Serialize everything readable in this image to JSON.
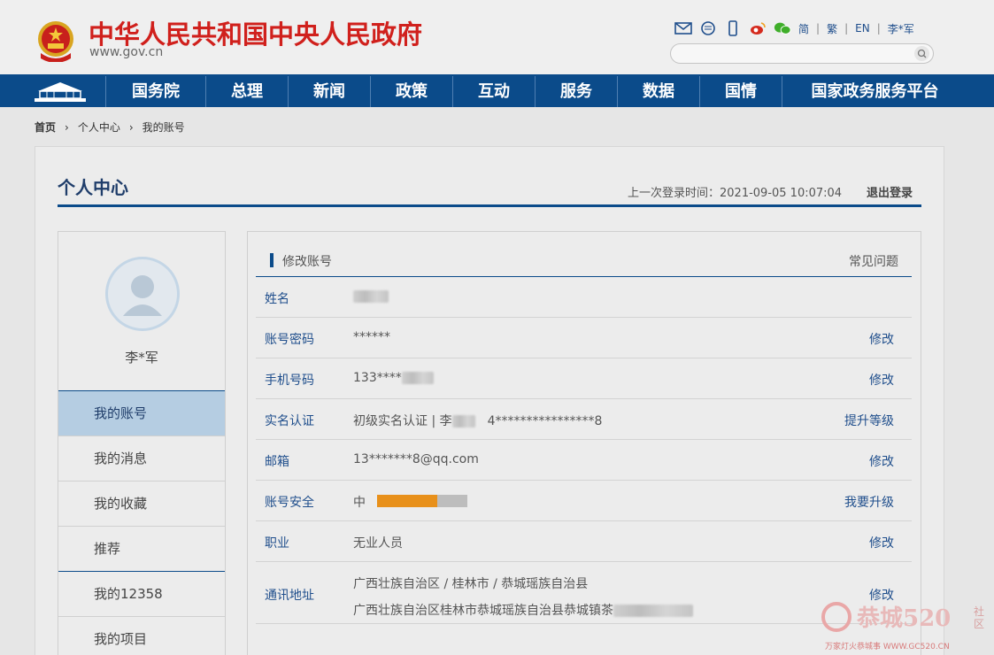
{
  "header": {
    "site_title": "中华人民共和国中央人民政府",
    "site_domain": "www.gov.cn",
    "lang_simplified": "简",
    "lang_traditional": "繁",
    "lang_english": "EN",
    "user_short": "李*军",
    "icons": [
      "mail-icon",
      "message-icon",
      "mobile-icon",
      "weibo-icon",
      "wechat-icon"
    ]
  },
  "nav": {
    "items": [
      "国务院",
      "总理",
      "新闻",
      "政策",
      "互动",
      "服务",
      "数据",
      "国情",
      "国家政务服务平台"
    ]
  },
  "breadcrumb": {
    "home": "首页",
    "level1": "个人中心",
    "current": "我的账号"
  },
  "page": {
    "title": "个人中心",
    "last_login": "上一次登录时间：2021-09-05 10:07:04",
    "logout": "退出登录"
  },
  "sidebar": {
    "user_name": "李*军",
    "items": [
      "我的账号",
      "我的消息",
      "我的收藏",
      "推荐",
      "我的12358",
      "我的项目"
    ],
    "active_index": 0
  },
  "account": {
    "section_title": "修改账号",
    "faq": "常见问题",
    "rows": [
      {
        "label": "姓名",
        "value": "",
        "action": ""
      },
      {
        "label": "账号密码",
        "value": "******",
        "action": "修改"
      },
      {
        "label": "手机号码",
        "value": "133****",
        "action": "修改"
      },
      {
        "label": "实名认证",
        "value": "初级实名认证  |  李",
        "value_b": "4****************8",
        "action": "提升等级"
      },
      {
        "label": "邮箱",
        "value": "13*******8@qq.com",
        "action": "修改"
      },
      {
        "label": "账号安全",
        "value": "中",
        "action": "我要升级"
      },
      {
        "label": "职业",
        "value": "无业人员",
        "action": "修改"
      },
      {
        "label": "通讯地址",
        "value": "广西壮族自治区 / 桂林市 / 恭城瑶族自治县",
        "value_b": "广西壮族自治区桂林市恭城瑶族自治县恭城镇茶",
        "action": "修改"
      }
    ],
    "security_level": {
      "filled": 2,
      "total": 3
    },
    "colors": {
      "filled": "#e8901a",
      "empty": "#bdbdbd"
    }
  },
  "watermark": {
    "text": "恭城520",
    "sub": "万家灯火恭城事 WWW.GC520.CN",
    "side": "社区"
  }
}
